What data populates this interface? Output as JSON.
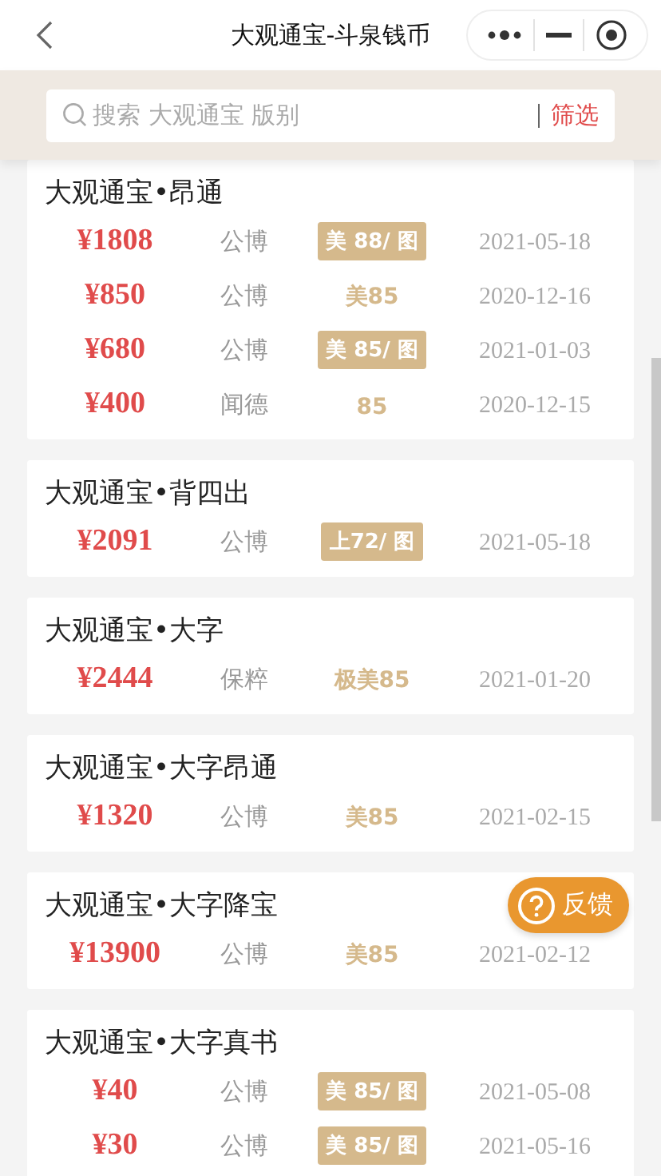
{
  "nav": {
    "title": "大观通宝-斗泉钱币"
  },
  "search": {
    "placeholder": "搜索 大观通宝 版别",
    "filter": "筛选"
  },
  "groups": [
    {
      "title": "大观通宝•昂通",
      "rows": [
        {
          "price": "¥1808",
          "org": "公博",
          "grade": "美 88/ 图",
          "kind": "tag",
          "date": "2021-05-18"
        },
        {
          "price": "¥850",
          "org": "公博",
          "grade": "美85",
          "kind": "plain",
          "date": "2020-12-16"
        },
        {
          "price": "¥680",
          "org": "公博",
          "grade": "美 85/ 图",
          "kind": "tag",
          "date": "2021-01-03"
        },
        {
          "price": "¥400",
          "org": "闻德",
          "grade": "85",
          "kind": "plain",
          "date": "2020-12-15"
        }
      ]
    },
    {
      "title": "大观通宝•背四出",
      "rows": [
        {
          "price": "¥2091",
          "org": "公博",
          "grade": "上72/ 图",
          "kind": "tag",
          "date": "2021-05-18"
        }
      ]
    },
    {
      "title": "大观通宝•大字",
      "rows": [
        {
          "price": "¥2444",
          "org": "保粹",
          "grade": "极美85",
          "kind": "plain",
          "date": "2021-01-20"
        }
      ]
    },
    {
      "title": "大观通宝•大字昂通",
      "rows": [
        {
          "price": "¥1320",
          "org": "公博",
          "grade": "美85",
          "kind": "plain",
          "date": "2021-02-15"
        }
      ]
    },
    {
      "title": "大观通宝•大字降宝",
      "rows": [
        {
          "price": "¥13900",
          "org": "公博",
          "grade": "美85",
          "kind": "plain",
          "date": "2021-02-12"
        }
      ]
    },
    {
      "title": "大观通宝•大字真书",
      "rows": [
        {
          "price": "¥40",
          "org": "公博",
          "grade": "美 85/ 图",
          "kind": "tag",
          "date": "2021-05-08"
        },
        {
          "price": "¥30",
          "org": "公博",
          "grade": "美 85/ 图",
          "kind": "tag",
          "date": "2021-05-16"
        }
      ]
    }
  ],
  "feedback": "反馈"
}
